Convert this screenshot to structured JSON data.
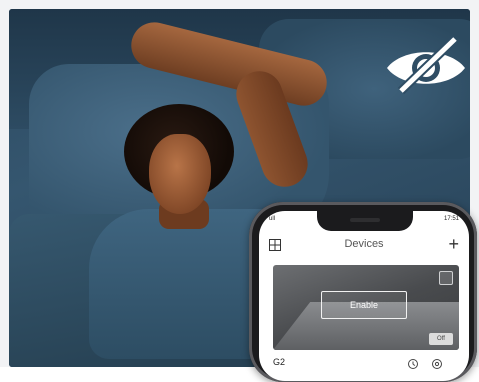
{
  "visibility_toggle": {
    "icon": "eye-slash-icon",
    "color": "#ffffff"
  },
  "phone": {
    "status_left": "ull ",
    "status_right": "17:51",
    "header": {
      "title": "Devices",
      "left_icon": "grid-icon",
      "right_icon": "plus-icon",
      "plus_label": "+"
    },
    "camera_card": {
      "enable_label": "Enable",
      "off_label": "Off"
    },
    "device": {
      "name": "G2",
      "icon_a": "history-icon",
      "icon_b": "settings-icon"
    }
  }
}
